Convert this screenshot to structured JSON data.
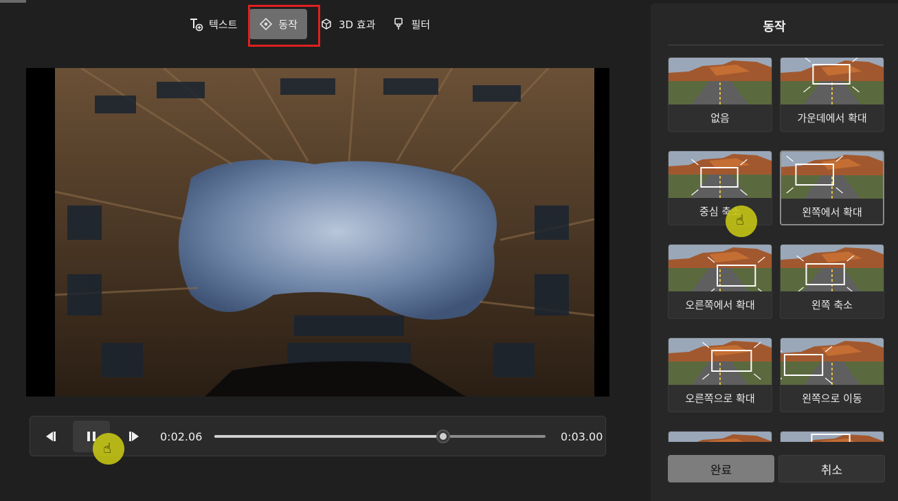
{
  "toolbar": {
    "items": [
      {
        "label": "텍스트",
        "icon": "text-add-icon"
      },
      {
        "label": "동작",
        "icon": "motion-icon"
      },
      {
        "label": "3D 효과",
        "icon": "3d-effects-icon"
      },
      {
        "label": "필터",
        "icon": "filter-brush-icon"
      }
    ],
    "active_index": 1
  },
  "player": {
    "current_time": "0:02.06",
    "total_time": "0:03.00",
    "progress": 0.69,
    "icons": {
      "prev": "previous-frame-icon",
      "pause": "pause-icon",
      "next": "next-frame-icon"
    }
  },
  "panel": {
    "title": "동작",
    "motions": [
      {
        "label": "없음",
        "icon": "none-motion-preview"
      },
      {
        "label": "가운데에서 확대",
        "icon": "zoom-in-center-preview"
      },
      {
        "label": "중심 축소",
        "icon": "zoom-out-center-preview"
      },
      {
        "label": "왼쪽에서 확대",
        "icon": "zoom-in-left-preview"
      },
      {
        "label": "오른쪽에서 확대",
        "icon": "zoom-in-right-preview"
      },
      {
        "label": "왼쪽 축소",
        "icon": "zoom-out-left-preview"
      },
      {
        "label": "오른쪽으로 확대",
        "icon": "zoom-in-to-right-preview"
      },
      {
        "label": "왼쪽으로 이동",
        "icon": "pan-left-preview"
      },
      {
        "label": "",
        "icon": "motion-preview"
      },
      {
        "label": "",
        "icon": "motion-preview"
      }
    ],
    "selected_index": 3,
    "done_label": "완료",
    "cancel_label": "취소"
  },
  "colors": {
    "highlight": "#e02020",
    "cursor_marker": "#c8c814"
  }
}
